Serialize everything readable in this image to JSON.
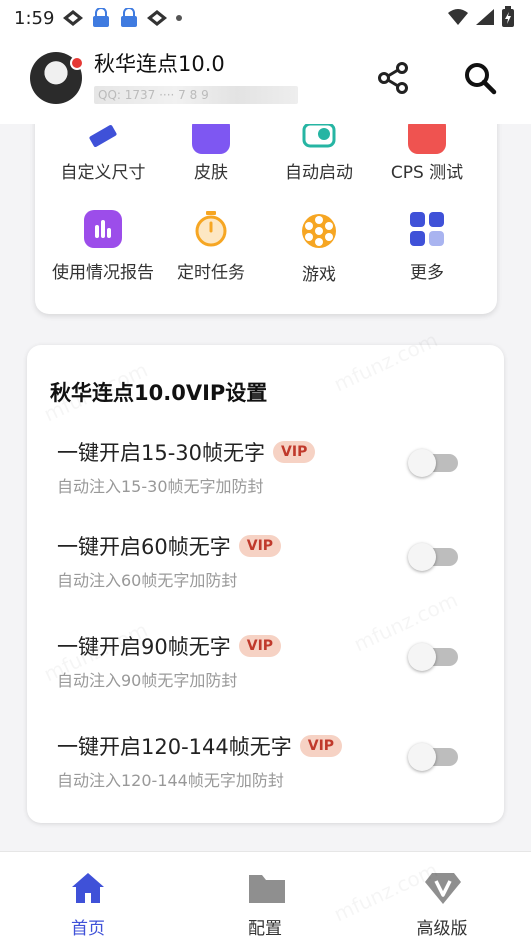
{
  "status_bar": {
    "time": "1:59",
    "icons": [
      "signal-diamond-icon",
      "lock-bars-icon",
      "lock-bars-icon",
      "signal-diamond-icon",
      "dot-icon"
    ],
    "right_icons": [
      "wifi-icon",
      "cell-signal-icon",
      "battery-icon"
    ]
  },
  "header": {
    "user_name": "秋华连点10.0",
    "user_sub": "QQ: 1737 ···· 7 8 9",
    "share_icon": "share-icon",
    "search_icon": "search-icon"
  },
  "features": {
    "row1": [
      {
        "label": "自定义尺寸",
        "icon": "ruler-icon",
        "color": "#3f51d8"
      },
      {
        "label": "皮肤",
        "icon": "skin-icon",
        "color": "#7e57f2"
      },
      {
        "label": "自动启动",
        "icon": "auto-start-icon",
        "color": "#26b5a3"
      },
      {
        "label": "CPS 测试",
        "icon": "cps-test-icon",
        "color": "#ef5350"
      }
    ],
    "row2": [
      {
        "label": "使用情况报告",
        "icon": "usage-report-icon",
        "color": "#9c4dea"
      },
      {
        "label": "定时任务",
        "icon": "timer-icon",
        "color": "#f6a623"
      },
      {
        "label": "游戏",
        "icon": "game-wheel-icon",
        "color": "#f6a623"
      },
      {
        "label": "更多",
        "icon": "more-grid-icon",
        "color": "#3f51d8"
      }
    ]
  },
  "vip": {
    "title": "秋华连点10.0VIP设置",
    "badge": "VIP",
    "options": [
      {
        "title": "一键开启15-30帧无字",
        "desc": "自动注入15-30帧无字加防封",
        "enabled": false
      },
      {
        "title": "一键开启60帧无字",
        "desc": "自动注入60帧无字加防封",
        "enabled": false
      },
      {
        "title": "一键开启90帧无字",
        "desc": "自动注入90帧无字加防封",
        "enabled": false
      },
      {
        "title": "一键开启120-144帧无字",
        "desc": "自动注入120-144帧无字加防封",
        "enabled": false
      }
    ]
  },
  "bottom_nav": [
    {
      "label": "首页",
      "icon": "home-icon",
      "active": true
    },
    {
      "label": "配置",
      "icon": "folder-icon",
      "active": false
    },
    {
      "label": "高级版",
      "icon": "premium-v-icon",
      "active": false
    }
  ],
  "colors": {
    "accent": "#3f51d8",
    "vip_badge_bg": "#f6d2c4",
    "vip_badge_text": "#c0392b",
    "switch_off": "#bdbdbd"
  },
  "watermark": "mfunz.com"
}
